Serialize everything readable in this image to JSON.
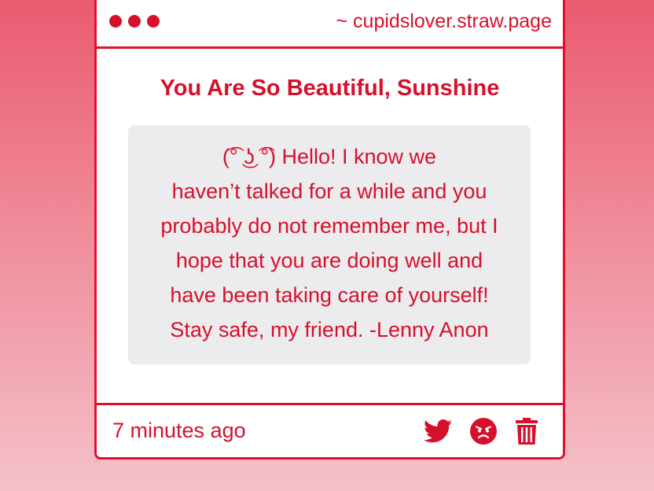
{
  "window": {
    "url": "~ cupidslover.straw.page"
  },
  "post": {
    "title": "You Are So Beautiful, Sunshine",
    "message_lines": [
      "(͡° ͜ʖ ͡°) Hello! I know we",
      "haven’t talked for a while and you",
      "probably do not remember me, but I",
      "hope that you are doing well and",
      "have been taking care of yourself!",
      "Stay safe, my friend. -Lenny Anon"
    ],
    "timestamp": "7 minutes ago"
  },
  "actions": {
    "twitter_icon": "twitter-icon",
    "angry_icon": "angry-face-icon",
    "trash_icon": "trash-icon"
  },
  "colors": {
    "accent": "#d6102b",
    "border": "#e0102c",
    "message_bg": "#ececee",
    "background_top": "#ea5b70",
    "background_bottom": "#f5c1c9"
  }
}
